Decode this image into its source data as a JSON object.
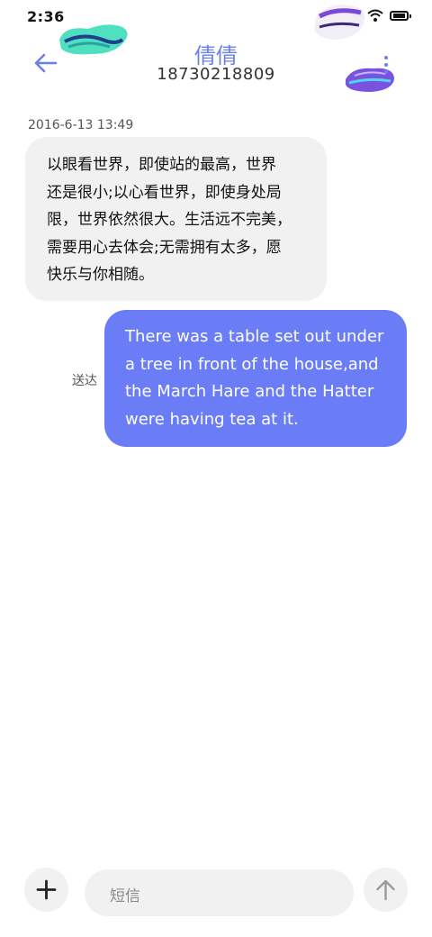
{
  "status_bar": {
    "time": "2:36",
    "icons": [
      "signal-icon",
      "wifi-icon",
      "battery-icon"
    ]
  },
  "header": {
    "contact_name": "倩倩",
    "contact_number": "18730218809",
    "back_icon": "arrow-left-icon",
    "more_icon": "more-vertical-icon",
    "accent_color": "#6b7ff0"
  },
  "conversation": {
    "timestamp": "2016-6-13 13:49",
    "incoming": {
      "lines": [
        "以眼看世界，即使站的最高，世界",
        "还是很小;以心看世界，即使身处局",
        "限，世界依然很大。生活远不完美，",
        "需要用心去体会;无需拥有太多，愿",
        "快乐与你相随。"
      ],
      "bubble_color": "#f1f1f1"
    },
    "outgoing": {
      "lines": [
        "There was a table set out under",
        "a tree in front of the house,and",
        "the March Hare and the Hatter",
        "were having tea at it."
      ],
      "status": "送达",
      "bubble_color": "#6a7df7"
    }
  },
  "composer": {
    "placeholder": "短信",
    "add_icon": "plus-icon",
    "send_icon": "arrow-up-icon"
  }
}
